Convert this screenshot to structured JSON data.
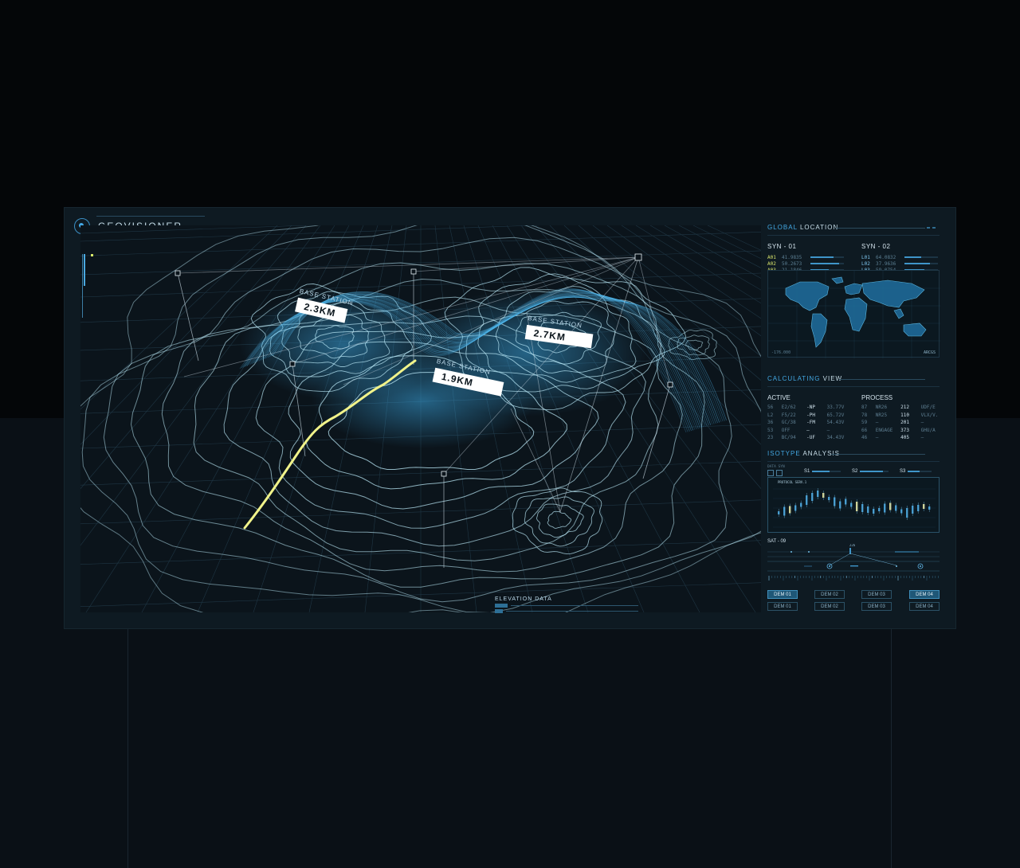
{
  "app": {
    "name": "GEOVISIONER"
  },
  "map": {
    "stations": [
      {
        "caption": "BASE STATION",
        "value": "2.3KM"
      },
      {
        "caption": "BASE STATION",
        "value": "2.7KM"
      },
      {
        "caption": "BASE STATION",
        "value": "1.9KM"
      }
    ],
    "elevation_label": "ELEVATION DATA",
    "colors": {
      "contour": "#bfeefc",
      "glow": "#4fb5ea",
      "path": "#f1f38a",
      "grid": "#1f3644"
    }
  },
  "global_location": {
    "title_accent": "GLOBAL",
    "title_rest": " LOCATION",
    "syn1": {
      "title": "SYN - 01",
      "rows": [
        {
          "key": "A01",
          "value": "41.9835",
          "fill": 0.7
        },
        {
          "key": "A02",
          "value": "50.2673",
          "fill": 0.85
        },
        {
          "key": "A03",
          "value": "21.1846",
          "fill": 0.55
        }
      ]
    },
    "syn2": {
      "title": "SYN - 02",
      "rows": [
        {
          "key": "L01",
          "value": "64.0832",
          "fill": 0.5
        },
        {
          "key": "L02",
          "value": "37.9636",
          "fill": 0.75
        },
        {
          "key": "L03",
          "value": "59.0754",
          "fill": 0.6
        }
      ]
    },
    "map_footer_right": "ARCGS"
  },
  "calculating_view": {
    "title_accent": "CALCULATING",
    "title_rest": " VIEW",
    "active": {
      "title": "ACTIVE",
      "rows": [
        [
          "56",
          "E2/62",
          "-NP",
          "33.77V"
        ],
        [
          "L2",
          "F5/22",
          "-PH",
          "65.72V"
        ],
        [
          "36",
          "GC/38",
          "-FM",
          "54.43V"
        ],
        [
          "53",
          "OFF",
          "–",
          "–"
        ],
        [
          "23",
          "BC/94",
          "-UF",
          "34.43V"
        ]
      ]
    },
    "process": {
      "title": "PROCESS",
      "rows": [
        [
          "87",
          "NR26",
          "212",
          "UDF/E"
        ],
        [
          "78",
          "NR25",
          "110",
          "VLX/V."
        ],
        [
          "59",
          "–",
          "201",
          "–"
        ],
        [
          "66",
          "ENGAGE",
          "373",
          "GHU/A"
        ],
        [
          "46",
          "–",
          "405",
          "–"
        ]
      ]
    }
  },
  "isotype": {
    "title_accent": "ISOTYPE",
    "title_rest": " ANALYSIS",
    "data_label": "DATA SYN",
    "s_items": [
      {
        "label": "S1",
        "fill": 0.6
      },
      {
        "label": "S2",
        "fill": 0.8
      },
      {
        "label": "S3",
        "fill": 0.5
      }
    ],
    "chart_title": "PROTOCOL SERV.1",
    "sat_label": "SAT - 09",
    "sat_marker": "226"
  },
  "dem_buttons": [
    {
      "label": "DEM 01",
      "active": true
    },
    {
      "label": "DEM 02",
      "active": false
    },
    {
      "label": "DEM 03",
      "active": false
    },
    {
      "label": "DEM 04",
      "active": true
    },
    {
      "label": "DEM 01",
      "active": false
    },
    {
      "label": "DEM 02",
      "active": false
    },
    {
      "label": "DEM 03",
      "active": false
    },
    {
      "label": "DEM 04",
      "active": false
    }
  ]
}
